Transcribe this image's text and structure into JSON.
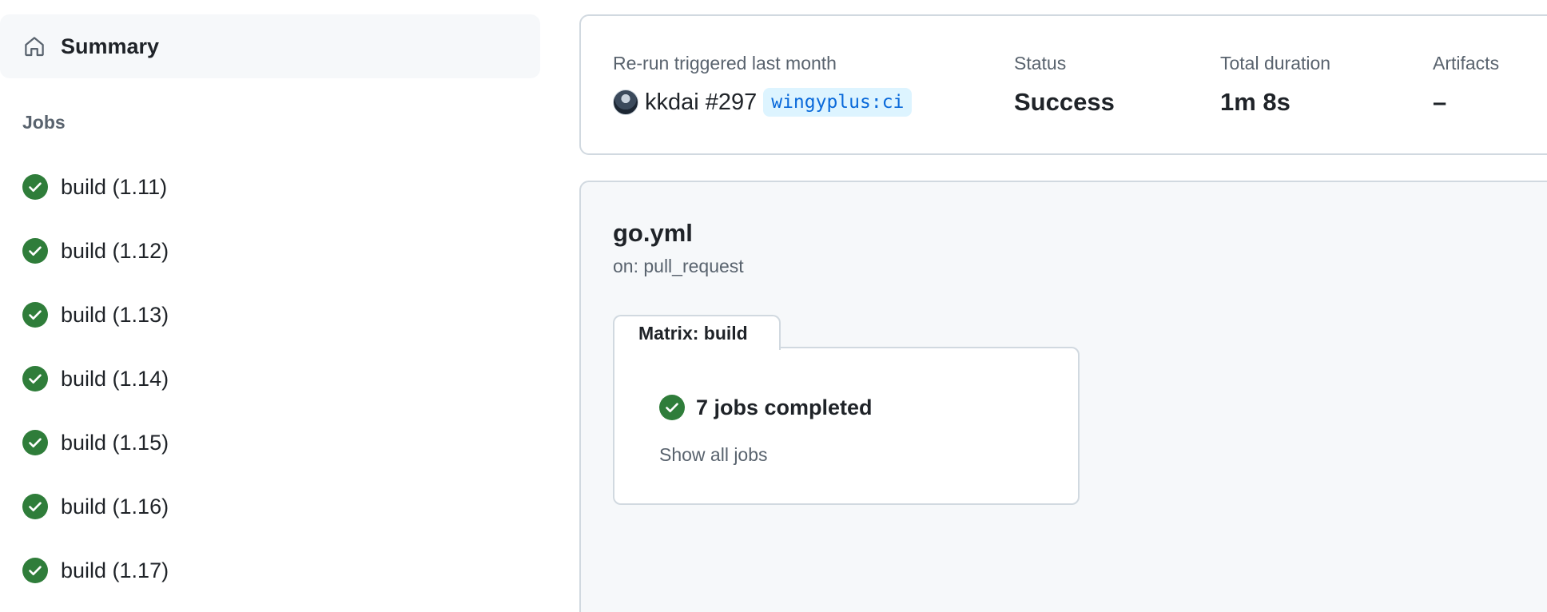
{
  "sidebar": {
    "summary": {
      "label": "Summary",
      "icon": "home-icon"
    },
    "jobs_heading": "Jobs",
    "jobs": [
      {
        "label": "build (1.11)",
        "status": "success"
      },
      {
        "label": "build (1.12)",
        "status": "success"
      },
      {
        "label": "build (1.13)",
        "status": "success"
      },
      {
        "label": "build (1.14)",
        "status": "success"
      },
      {
        "label": "build (1.15)",
        "status": "success"
      },
      {
        "label": "build (1.16)",
        "status": "success"
      },
      {
        "label": "build (1.17)",
        "status": "success"
      }
    ]
  },
  "run": {
    "trigger_label": "Re-run triggered last month",
    "actor": "kkdai",
    "run_number": "#297",
    "branch": "wingyplus:ci",
    "status_label": "Status",
    "status_value": "Success",
    "duration_label": "Total duration",
    "duration_value": "1m 8s",
    "artifacts_label": "Artifacts",
    "artifacts_value": "–"
  },
  "workflow": {
    "name": "go.yml",
    "trigger": "on: pull_request",
    "matrix_tab": "Matrix: build",
    "jobs_completed": "7 jobs completed",
    "show_all": "Show all jobs"
  },
  "colors": {
    "success": "#2f7d3a",
    "branch_bg": "#ddf4ff",
    "branch_fg": "#0969da",
    "muted": "#59636e",
    "border": "#d1d9e0"
  }
}
